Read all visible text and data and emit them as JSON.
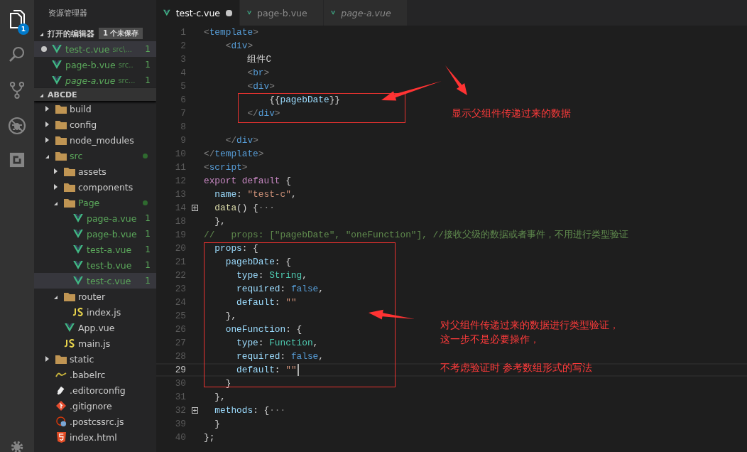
{
  "activity_bar": [
    {
      "kind": "files",
      "selected": true,
      "badge": "1"
    },
    {
      "kind": "search",
      "selected": false
    },
    {
      "kind": "git",
      "selected": false
    },
    {
      "kind": "debug",
      "selected": false
    },
    {
      "kind": "extensions",
      "selected": false
    }
  ],
  "sidebar": {
    "title": "资源管理器",
    "open_editors": {
      "title": "打开的编辑器",
      "badge": "1 个未保存",
      "expanded": true,
      "items": [
        {
          "name": "test-c.vue",
          "path": "src\\...",
          "count": "1",
          "dirty": true,
          "selected": true,
          "preview": false
        },
        {
          "name": "page-b.vue",
          "path": "src..",
          "count": "1",
          "dirty": false,
          "selected": false,
          "preview": false
        },
        {
          "name": "page-a.vue",
          "path": "src...",
          "count": "1",
          "dirty": false,
          "selected": false,
          "preview": true
        }
      ]
    },
    "project": {
      "title": "ABCDE",
      "expanded": true,
      "items": [
        {
          "name": "build",
          "kind": "folder",
          "expanded": false,
          "modified": false,
          "dot": false,
          "selected": false
        },
        {
          "name": "config",
          "kind": "folder",
          "expanded": false,
          "modified": false,
          "dot": false,
          "selected": false
        },
        {
          "name": "node_modules",
          "kind": "folder",
          "expanded": false,
          "modified": false,
          "dot": false,
          "selected": false
        },
        {
          "name": "src",
          "kind": "folder",
          "expanded": true,
          "modified": true,
          "dot": true,
          "selected": false,
          "children": [
            {
              "name": "assets",
              "kind": "folder",
              "expanded": false,
              "modified": false,
              "dot": false,
              "selected": false
            },
            {
              "name": "components",
              "kind": "folder",
              "expanded": false,
              "modified": false,
              "dot": false,
              "selected": false
            },
            {
              "name": "Page",
              "kind": "folder",
              "expanded": true,
              "modified": true,
              "dot": true,
              "selected": false,
              "children": [
                {
                  "name": "page-a.vue",
                  "kind": "vue",
                  "modified": true,
                  "count": "1",
                  "dot": false,
                  "selected": false
                },
                {
                  "name": "page-b.vue",
                  "kind": "vue",
                  "modified": true,
                  "count": "1",
                  "dot": false,
                  "selected": false
                },
                {
                  "name": "test-a.vue",
                  "kind": "vue",
                  "modified": true,
                  "count": "1",
                  "dot": false,
                  "selected": false
                },
                {
                  "name": "test-b.vue",
                  "kind": "vue",
                  "modified": true,
                  "count": "1",
                  "dot": false,
                  "selected": false
                },
                {
                  "name": "test-c.vue",
                  "kind": "vue",
                  "modified": true,
                  "count": "1",
                  "dot": false,
                  "selected": true
                }
              ]
            },
            {
              "name": "router",
              "kind": "folder",
              "expanded": true,
              "modified": false,
              "dot": false,
              "selected": false,
              "children": [
                {
                  "name": "index.js",
                  "kind": "js",
                  "modified": false,
                  "dot": false,
                  "selected": false
                }
              ]
            },
            {
              "name": "App.vue",
              "kind": "vue",
              "modified": false,
              "dot": false,
              "selected": false
            },
            {
              "name": "main.js",
              "kind": "js",
              "modified": false,
              "dot": false,
              "selected": false
            }
          ]
        },
        {
          "name": "static",
          "kind": "folder",
          "expanded": false,
          "modified": false,
          "dot": false,
          "selected": false
        },
        {
          "name": ".babelrc",
          "kind": "babel",
          "modified": false,
          "dot": false,
          "selected": false
        },
        {
          "name": ".editorconfig",
          "kind": "editorconfig",
          "modified": false,
          "dot": false,
          "selected": false
        },
        {
          "name": ".gitignore",
          "kind": "git",
          "modified": false,
          "dot": false,
          "selected": false
        },
        {
          "name": ".postcssrc.js",
          "kind": "postcss",
          "modified": false,
          "dot": false,
          "selected": false
        },
        {
          "name": "index.html",
          "kind": "html",
          "modified": false,
          "dot": false,
          "selected": false
        }
      ]
    }
  },
  "tabs": [
    {
      "label": "test-c.vue",
      "selected": true,
      "dirty": true,
      "preview": false
    },
    {
      "label": "page-b.vue",
      "selected": false,
      "dirty": false,
      "preview": false
    },
    {
      "label": "page-a.vue",
      "selected": false,
      "dirty": false,
      "preview": true
    }
  ],
  "editor": {
    "lines": [
      {
        "num": "1",
        "fold": false,
        "current": false,
        "tokens": [
          {
            "kind": "br",
            "text": "<"
          },
          {
            "kind": "tag",
            "text": "template"
          },
          {
            "kind": "br",
            "text": ">"
          }
        ]
      },
      {
        "num": "2",
        "fold": false,
        "current": false,
        "tokens": [
          {
            "kind": "br",
            "text": "    <"
          },
          {
            "kind": "tag",
            "text": "div"
          },
          {
            "kind": "br",
            "text": ">"
          }
        ]
      },
      {
        "num": "3",
        "fold": false,
        "current": false,
        "tokens": [
          {
            "kind": "text",
            "text": "        组件C"
          }
        ]
      },
      {
        "num": "4",
        "fold": false,
        "current": false,
        "tokens": [
          {
            "kind": "br",
            "text": "        <"
          },
          {
            "kind": "tag",
            "text": "br"
          },
          {
            "kind": "br",
            "text": ">"
          }
        ]
      },
      {
        "num": "5",
        "fold": false,
        "current": false,
        "tokens": [
          {
            "kind": "br",
            "text": "        <"
          },
          {
            "kind": "tag",
            "text": "div"
          },
          {
            "kind": "br",
            "text": ">"
          }
        ]
      },
      {
        "num": "6",
        "fold": false,
        "current": false,
        "tokens": [
          {
            "kind": "text",
            "text": "            {{"
          },
          {
            "kind": "prop",
            "text": "pagebDate"
          },
          {
            "kind": "text",
            "text": "}}"
          }
        ]
      },
      {
        "num": "7",
        "fold": false,
        "current": false,
        "tokens": [
          {
            "kind": "br",
            "text": "        </"
          },
          {
            "kind": "tag",
            "text": "div"
          },
          {
            "kind": "br",
            "text": ">"
          }
        ]
      },
      {
        "num": "8",
        "fold": false,
        "current": false
      },
      {
        "num": "9",
        "fold": false,
        "current": false,
        "tokens": [
          {
            "kind": "br",
            "text": "    </"
          },
          {
            "kind": "tag",
            "text": "div"
          },
          {
            "kind": "br",
            "text": ">"
          }
        ]
      },
      {
        "num": "10",
        "fold": false,
        "current": false,
        "tokens": [
          {
            "kind": "br",
            "text": "</"
          },
          {
            "kind": "tag",
            "text": "template"
          },
          {
            "kind": "br",
            "text": ">"
          }
        ]
      },
      {
        "num": "11",
        "fold": false,
        "current": false,
        "tokens": [
          {
            "kind": "br",
            "text": "<"
          },
          {
            "kind": "tag",
            "text": "script"
          },
          {
            "kind": "br",
            "text": ">"
          }
        ]
      },
      {
        "num": "12",
        "fold": false,
        "current": false,
        "tokens": [
          {
            "kind": "kw",
            "text": "export default"
          },
          {
            "kind": "text",
            "text": " {"
          }
        ]
      },
      {
        "num": "13",
        "fold": false,
        "current": false,
        "tokens": [
          {
            "kind": "prop",
            "text": "  name"
          },
          {
            "kind": "text",
            "text": ": "
          },
          {
            "kind": "str",
            "text": "\"test-c\""
          },
          {
            "kind": "text",
            "text": ","
          }
        ]
      },
      {
        "num": "14",
        "fold": true,
        "current": false,
        "tokens": [
          {
            "kind": "fn",
            "text": "  data"
          },
          {
            "kind": "text",
            "text": "() {"
          },
          {
            "kind": "ell",
            "text": "···"
          }
        ]
      },
      {
        "num": "18",
        "fold": false,
        "current": false,
        "tokens": [
          {
            "kind": "text",
            "text": "  },"
          }
        ]
      },
      {
        "num": "19",
        "fold": false,
        "current": false,
        "tokens": [
          {
            "kind": "comment",
            "text": "//   props: [\"pagebDate\", \"oneFunction\"], //接收父级的数据或者事件，不用进行类型验证"
          }
        ]
      },
      {
        "num": "20",
        "fold": false,
        "current": false,
        "tokens": [
          {
            "kind": "prop",
            "text": "  props"
          },
          {
            "kind": "text",
            "text": ": {"
          }
        ]
      },
      {
        "num": "21",
        "fold": false,
        "current": false,
        "tokens": [
          {
            "kind": "prop",
            "text": "    pagebDate"
          },
          {
            "kind": "text",
            "text": ": {"
          }
        ]
      },
      {
        "num": "22",
        "fold": false,
        "current": false,
        "tokens": [
          {
            "kind": "prop",
            "text": "      type"
          },
          {
            "kind": "text",
            "text": ": "
          },
          {
            "kind": "type",
            "text": "String"
          },
          {
            "kind": "text",
            "text": ","
          }
        ]
      },
      {
        "num": "23",
        "fold": false,
        "current": false,
        "tokens": [
          {
            "kind": "prop",
            "text": "      required"
          },
          {
            "kind": "text",
            "text": ": "
          },
          {
            "kind": "bool",
            "text": "false"
          },
          {
            "kind": "text",
            "text": ","
          }
        ]
      },
      {
        "num": "24",
        "fold": false,
        "current": false,
        "tokens": [
          {
            "kind": "prop",
            "text": "      default"
          },
          {
            "kind": "text",
            "text": ": "
          },
          {
            "kind": "str",
            "text": "\"\""
          }
        ]
      },
      {
        "num": "25",
        "fold": false,
        "current": false,
        "tokens": [
          {
            "kind": "text",
            "text": "    },"
          }
        ]
      },
      {
        "num": "26",
        "fold": false,
        "current": false,
        "tokens": [
          {
            "kind": "prop",
            "text": "    oneFunction"
          },
          {
            "kind": "text",
            "text": ": {"
          }
        ]
      },
      {
        "num": "27",
        "fold": false,
        "current": false,
        "tokens": [
          {
            "kind": "prop",
            "text": "      type"
          },
          {
            "kind": "text",
            "text": ": "
          },
          {
            "kind": "type",
            "text": "Function"
          },
          {
            "kind": "text",
            "text": ","
          }
        ]
      },
      {
        "num": "28",
        "fold": false,
        "current": false,
        "tokens": [
          {
            "kind": "prop",
            "text": "      required"
          },
          {
            "kind": "text",
            "text": ": "
          },
          {
            "kind": "bool",
            "text": "false"
          },
          {
            "kind": "text",
            "text": ","
          }
        ]
      },
      {
        "num": "29",
        "fold": false,
        "current": true,
        "tokens": [
          {
            "kind": "prop",
            "text": "      default"
          },
          {
            "kind": "text",
            "text": ": "
          },
          {
            "kind": "str",
            "text": "\"\""
          }
        ]
      },
      {
        "num": "30",
        "fold": false,
        "current": false,
        "tokens": [
          {
            "kind": "text",
            "text": "    }"
          }
        ]
      },
      {
        "num": "31",
        "fold": false,
        "current": false,
        "tokens": [
          {
            "kind": "text",
            "text": "  },"
          }
        ]
      },
      {
        "num": "32",
        "fold": true,
        "current": false,
        "tokens": [
          {
            "kind": "prop",
            "text": "  methods"
          },
          {
            "kind": "text",
            "text": ": {"
          },
          {
            "kind": "ell",
            "text": "···"
          }
        ]
      },
      {
        "num": "39",
        "fold": false,
        "current": false,
        "tokens": [
          {
            "kind": "text",
            "text": "  }"
          }
        ]
      },
      {
        "num": "40",
        "fold": false,
        "current": false,
        "tokens": [
          {
            "kind": "text",
            "text": "};"
          }
        ]
      }
    ]
  },
  "annotations": {
    "notes": [
      {
        "lines": [
          "显示父组件传递过来的数据"
        ]
      },
      {
        "lines": [
          "对父组件传递过来的数据进行类型验证，",
          "这一步不是必要操作，"
        ]
      },
      {
        "lines": [
          "不考虑验证时  参考数组形式的写法"
        ]
      }
    ]
  }
}
